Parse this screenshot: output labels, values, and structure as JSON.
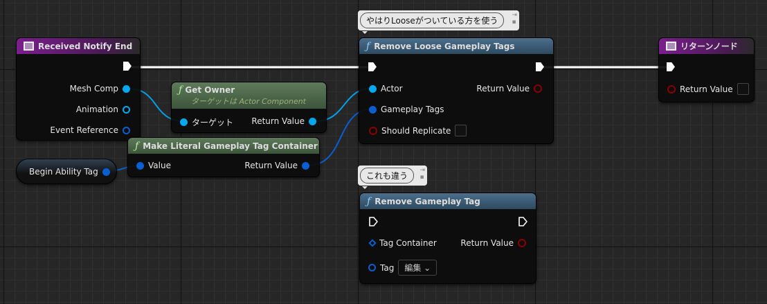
{
  "comments": {
    "c1": "やはりLooseがついている方を使う",
    "c2": "これも違う"
  },
  "received": {
    "title": "Received Notify End",
    "pins": [
      "Mesh Comp",
      "Animation",
      "Event Reference"
    ]
  },
  "get_owner": {
    "title": "Get Owner",
    "subtitle": "ターゲットは Actor Component",
    "in": "ターゲット",
    "out": "Return Value"
  },
  "make_literal": {
    "title": "Make Literal Gameplay Tag Container",
    "in": "Value",
    "out": "Return Value"
  },
  "variable": {
    "label": "Begin Ability Tag"
  },
  "remove_loose": {
    "title": "Remove Loose Gameplay Tags",
    "pins": [
      "Actor",
      "Gameplay Tags",
      "Should Replicate"
    ],
    "out": "Return Value"
  },
  "return_node": {
    "title": "リターンノード",
    "pin": "Return Value"
  },
  "remove_tag": {
    "title": "Remove Gameplay Tag",
    "pins": [
      "Tag Container",
      "Tag"
    ],
    "out": "Return Value",
    "dropdown": "編集"
  },
  "colors": {
    "event": "#7a1f8c",
    "function": "#4c6f8c",
    "pure": "#5d7a5a",
    "object_pin": "#00a8f0",
    "struct_pin": "#0a5fd0",
    "bool_pin": "#8a0000"
  }
}
